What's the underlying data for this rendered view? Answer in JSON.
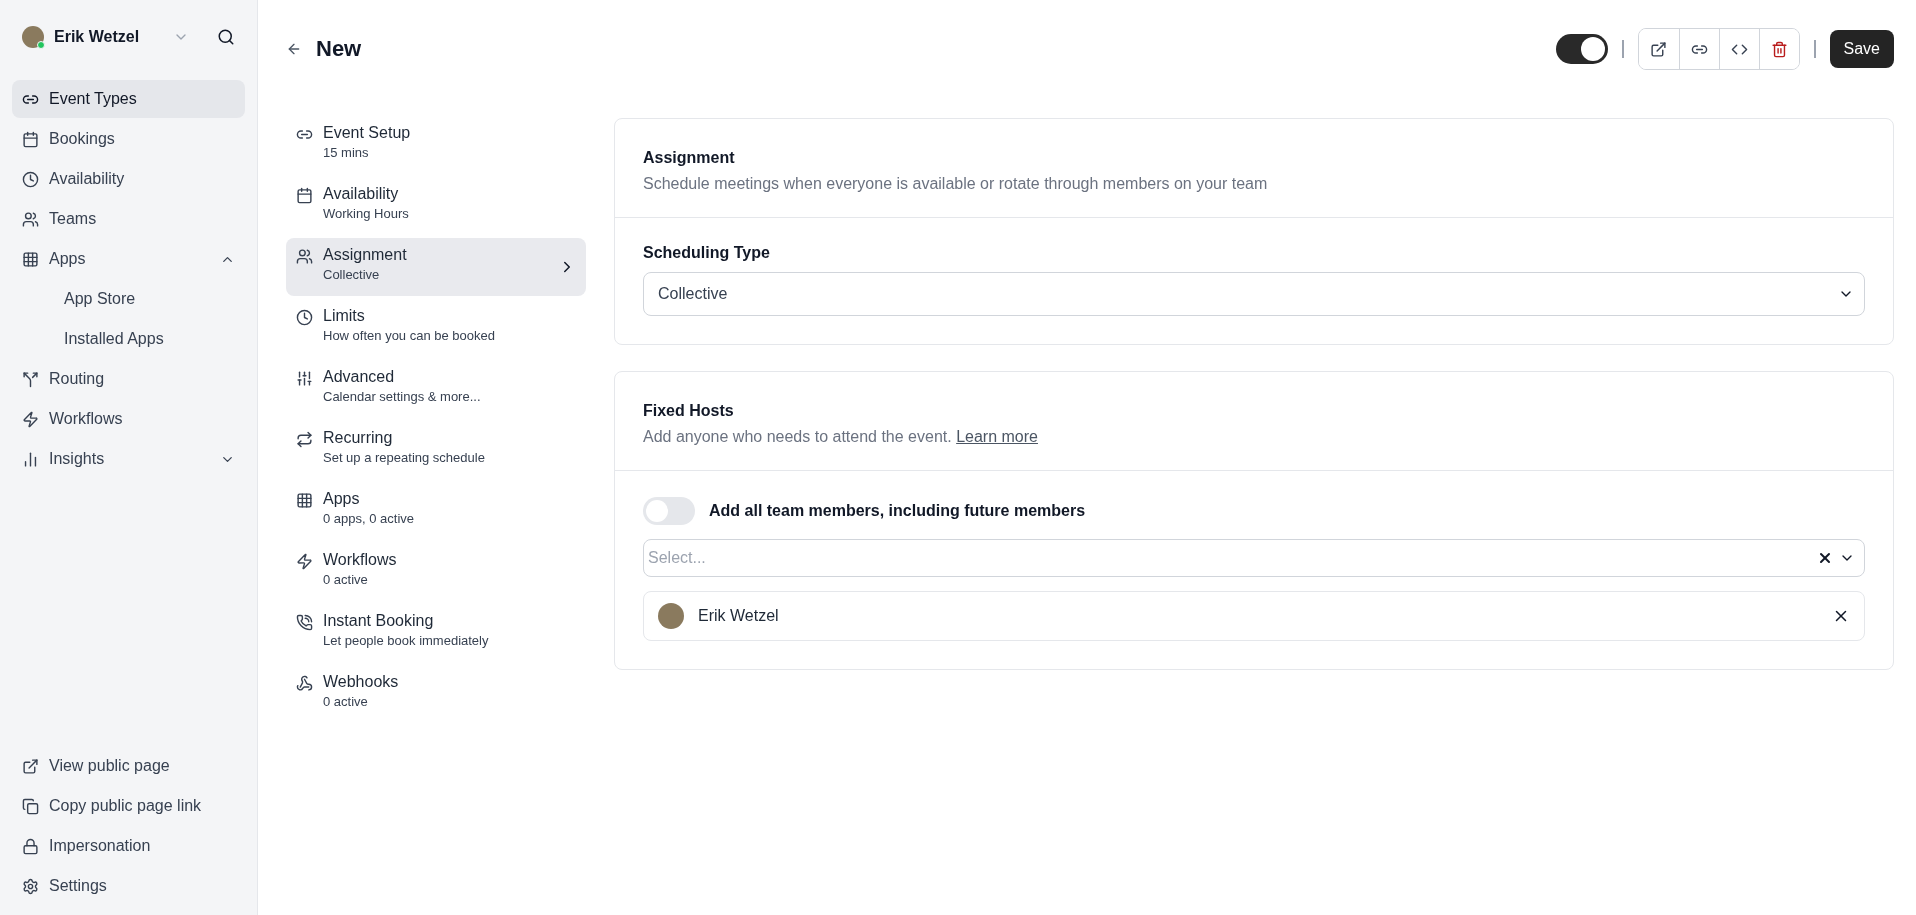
{
  "user": {
    "name": "Erik Wetzel"
  },
  "sidebar": {
    "items": [
      {
        "label": "Event Types",
        "selected": true
      },
      {
        "label": "Bookings",
        "selected": false
      },
      {
        "label": "Availability",
        "selected": false
      },
      {
        "label": "Teams",
        "selected": false
      },
      {
        "label": "Apps",
        "selected": false,
        "expanded": true,
        "children": [
          {
            "label": "App Store",
            "selected": false
          },
          {
            "label": "Installed Apps",
            "selected": false
          }
        ]
      },
      {
        "label": "Routing",
        "selected": false
      },
      {
        "label": "Workflows",
        "selected": false
      },
      {
        "label": "Insights",
        "selected": false,
        "expanded": false
      }
    ],
    "footer": [
      {
        "label": "View public page"
      },
      {
        "label": "Copy public page link"
      },
      {
        "label": "Impersonation"
      },
      {
        "label": "Settings"
      }
    ]
  },
  "header": {
    "title": "New",
    "hidden_toggle": {
      "on": true
    },
    "save": "Save"
  },
  "event_nav": [
    {
      "title": "Event Setup",
      "subtitle": "15 mins",
      "selected": false
    },
    {
      "title": "Availability",
      "subtitle": "Working Hours",
      "selected": false
    },
    {
      "title": "Assignment",
      "subtitle": "Collective",
      "selected": true
    },
    {
      "title": "Limits",
      "subtitle": "How often you can be booked",
      "selected": false
    },
    {
      "title": "Advanced",
      "subtitle": "Calendar settings & more...",
      "selected": false
    },
    {
      "title": "Recurring",
      "subtitle": "Set up a repeating schedule",
      "selected": false
    },
    {
      "title": "Apps",
      "subtitle": "0 apps, 0 active",
      "selected": false
    },
    {
      "title": "Workflows",
      "subtitle": "0 active",
      "selected": false
    },
    {
      "title": "Instant Booking",
      "subtitle": "Let people book immediately",
      "selected": false
    },
    {
      "title": "Webhooks",
      "subtitle": "0 active",
      "selected": false
    }
  ],
  "assignment": {
    "title": "Assignment",
    "description": "Schedule meetings when everyone is available or rotate through members on your team",
    "scheduling_type_label": "Scheduling Type",
    "scheduling_type": "Collective"
  },
  "fixed_hosts": {
    "title": "Fixed Hosts",
    "description": "Add anyone who needs to attend the event.",
    "link": "Learn more",
    "all_members_toggle": {
      "label": "Add all team members, including future members",
      "on": false
    },
    "select": {
      "placeholder": "Select..."
    },
    "hosts": [
      {
        "name": "Erik Wetzel"
      }
    ]
  }
}
